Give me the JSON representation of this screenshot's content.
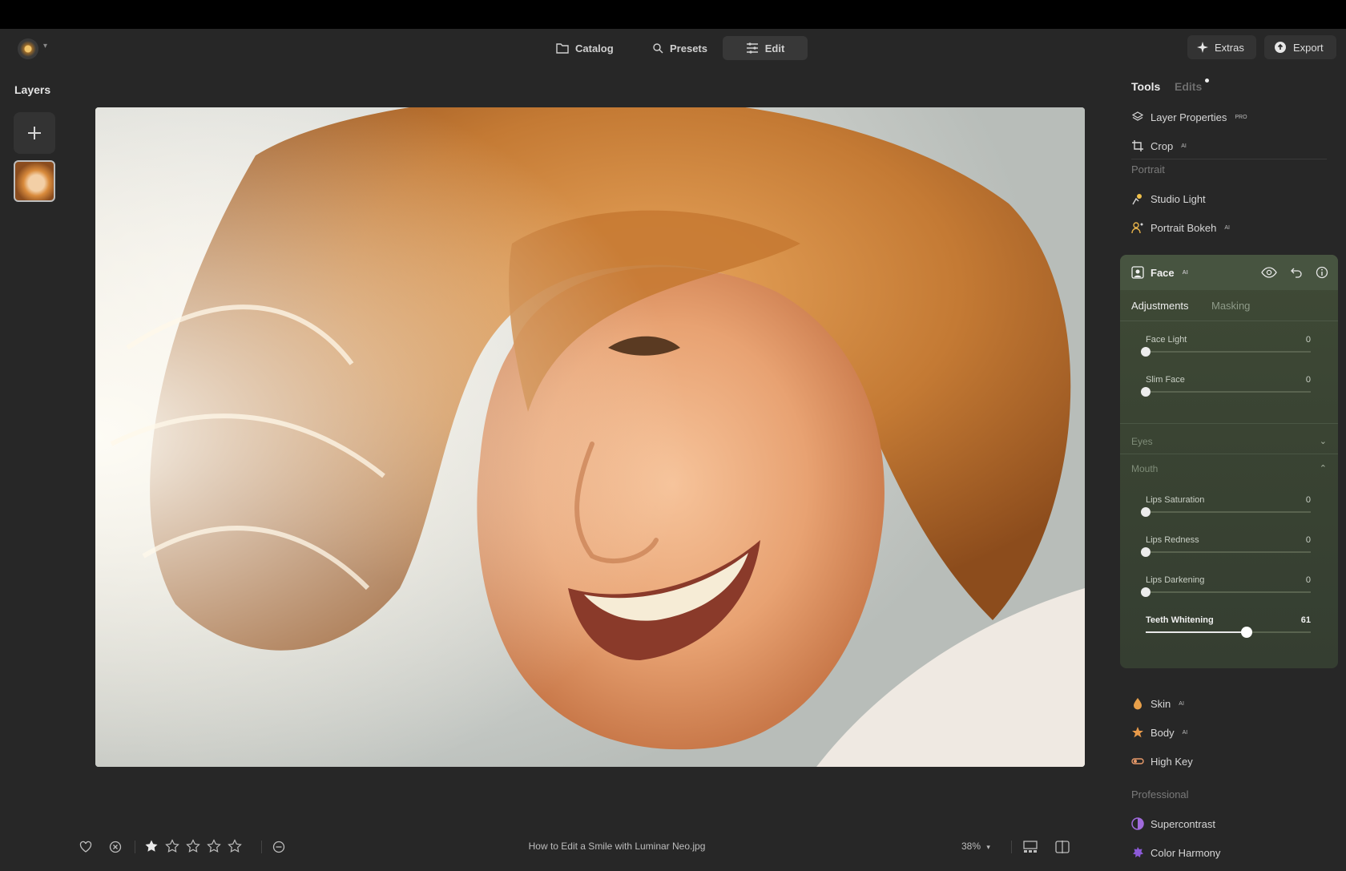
{
  "topbar": {
    "nav": [
      {
        "label": "Catalog",
        "icon": "folder-icon"
      },
      {
        "label": "Presets",
        "icon": "search-icon"
      },
      {
        "label": "Edit",
        "icon": "sliders-icon",
        "active": true
      }
    ],
    "extras_label": "Extras",
    "export_label": "Export"
  },
  "layers": {
    "title": "Layers",
    "thumbnail": "portrait-thumbnail"
  },
  "photo": {
    "subject": "smiling woman with curly red hair in sunlight"
  },
  "bottombar": {
    "filename": "How to Edit a Smile with Luminar Neo.jpg",
    "rating": {
      "filled": 1,
      "total": 5
    },
    "zoom": "38%"
  },
  "panel": {
    "tabs": {
      "tools": "Tools",
      "edits": "Edits"
    },
    "tools_top": [
      {
        "label": "Layer Properties",
        "icon": "layers-icon",
        "badge": "PRO"
      },
      {
        "label": "Crop",
        "icon": "crop-icon",
        "badge": "AI"
      }
    ],
    "portrait_section": "Portrait",
    "portrait_tools": [
      {
        "label": "Studio Light",
        "icon": "studio-light-icon"
      },
      {
        "label": "Portrait Bokeh",
        "icon": "portrait-bokeh-icon",
        "badge": "AI"
      }
    ],
    "face": {
      "title": "Face",
      "badge": "AI",
      "subtabs": {
        "adjustments": "Adjustments",
        "masking": "Masking"
      },
      "sliders_top": [
        {
          "label": "Face Light",
          "value": "0",
          "level": 0
        },
        {
          "label": "Slim Face",
          "value": "0",
          "level": 0
        }
      ],
      "eyes_label": "Eyes",
      "mouth_label": "Mouth",
      "sliders_mouth": [
        {
          "label": "Lips Saturation",
          "value": "0",
          "level": 0
        },
        {
          "label": "Lips Redness",
          "value": "0",
          "level": 0
        },
        {
          "label": "Lips Darkening",
          "value": "0",
          "level": 0
        },
        {
          "label": "Teeth Whitening",
          "value": "61",
          "level": 0.61
        }
      ]
    },
    "tools_bottom": [
      {
        "label": "Skin",
        "icon": "skin-icon",
        "badge": "AI"
      },
      {
        "label": "Body",
        "icon": "body-icon",
        "badge": "AI"
      },
      {
        "label": "High Key",
        "icon": "high-key-icon"
      }
    ],
    "professional_section": "Professional",
    "professional_tools": [
      {
        "label": "Supercontrast",
        "icon": "supercontrast-icon"
      },
      {
        "label": "Color Harmony",
        "icon": "color-harmony-icon"
      }
    ]
  }
}
